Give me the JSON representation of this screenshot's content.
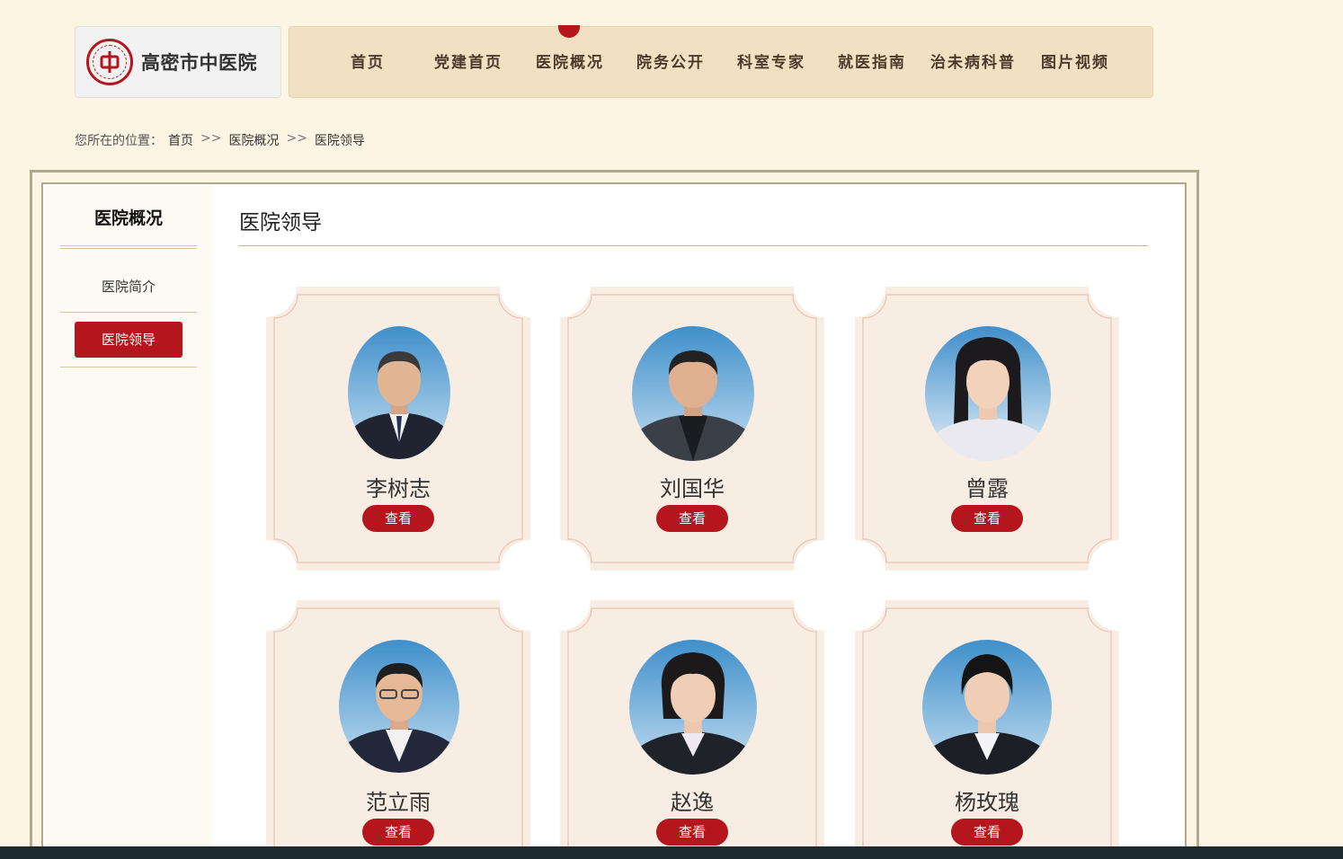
{
  "site": {
    "name": "高密市中医院",
    "logo_icon": "hospital-emblem-icon"
  },
  "nav": {
    "items": [
      {
        "label": "首页"
      },
      {
        "label": "党建首页"
      },
      {
        "label": "医院概况",
        "active": true
      },
      {
        "label": "院务公开"
      },
      {
        "label": "科室专家"
      },
      {
        "label": "就医指南"
      },
      {
        "label": "治未病科普"
      },
      {
        "label": "图片视频"
      }
    ]
  },
  "breadcrumb": {
    "prefix": "您所在的位置：",
    "items": [
      "首页",
      "医院概况",
      "医院领导"
    ],
    "separator": ">>"
  },
  "sidebar": {
    "title": "医院概况",
    "items": [
      {
        "label": "医院简介",
        "active": false
      },
      {
        "label": "医院领导",
        "active": true
      }
    ]
  },
  "content": {
    "title": "医院领导",
    "leaders": [
      {
        "name": "李树志",
        "button": "查看"
      },
      {
        "name": "刘国华",
        "button": "查看"
      },
      {
        "name": "曾露",
        "button": "查看"
      },
      {
        "name": "范立雨",
        "button": "查看"
      },
      {
        "name": "赵逸",
        "button": "查看"
      },
      {
        "name": "杨玫瑰",
        "button": "查看"
      }
    ]
  },
  "colors": {
    "accent": "#b5161e",
    "page_bg": "#fdf5e3",
    "nav_bg": "#f2e0c2",
    "card_bg": "#f7ede2",
    "frame": "#b3a88e"
  }
}
